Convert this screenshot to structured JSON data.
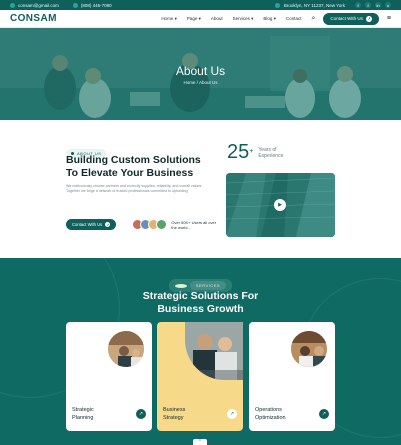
{
  "topbar": {
    "email": "consam@gmail.com",
    "phone": "(808) 446-7080",
    "address": "Brooklyn, NY 11237, New York",
    "social": [
      "f",
      "f",
      "in",
      "x"
    ]
  },
  "nav": {
    "logo": "CONSAM",
    "items": [
      "Home",
      "Page",
      "About",
      "Services",
      "Blog",
      "Contact"
    ],
    "cta": "Contact With Us"
  },
  "hero": {
    "title": "About Us",
    "breadcrumb_home": "Home",
    "breadcrumb_sep": "/",
    "breadcrumb_current": "About Us"
  },
  "about": {
    "badge": "ABOUT US",
    "title_line1": "Building Custom Solutions",
    "title_line2": "To Elevate Your Business",
    "text": "We meticulously choose partners and correctly supplies, reliability, and overall values. Together we forge a network of trusted professionals committed to upholding",
    "button": "Contact With Us",
    "users_text": "Over 50K+ Users all over the world...",
    "stat_number": "25",
    "stat_sup": "+",
    "stat_label_1": "Years of",
    "stat_label_2": "Experience",
    "play_icon": "play-icon"
  },
  "services": {
    "badge": "SERVICES",
    "title_line1": "Strategic Solutions For",
    "title_line2": "Business Growth",
    "cards": [
      {
        "line1": "Strategic",
        "line2": "Planning"
      },
      {
        "line1": "Business",
        "line2": "Strategy"
      },
      {
        "line1": "Operations",
        "line2": "Optimization"
      }
    ]
  },
  "colors": {
    "primary": "#0f5f5a",
    "highlight": "#f7d98a"
  }
}
